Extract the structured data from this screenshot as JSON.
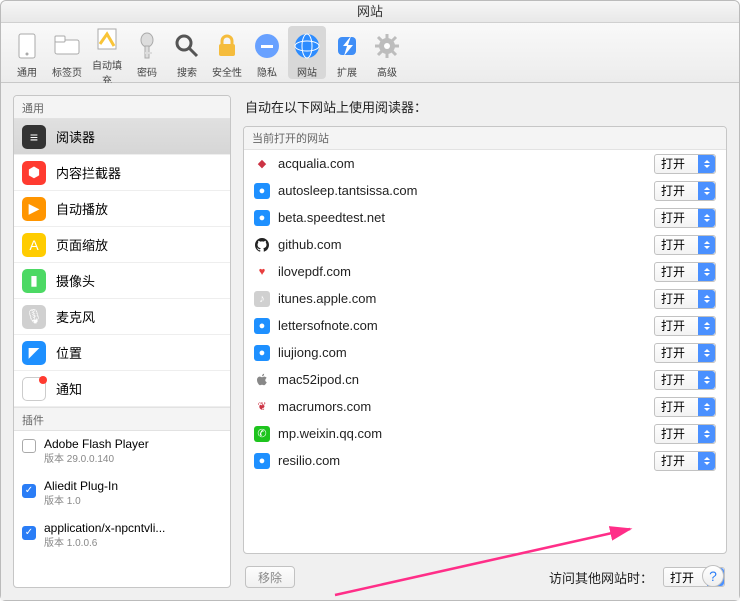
{
  "window_title": "网站",
  "toolbar": [
    {
      "name": "general",
      "label": "通用"
    },
    {
      "name": "tabs",
      "label": "标签页"
    },
    {
      "name": "autofill",
      "label": "自动填充"
    },
    {
      "name": "passwords",
      "label": "密码"
    },
    {
      "name": "search",
      "label": "搜索"
    },
    {
      "name": "security",
      "label": "安全性"
    },
    {
      "name": "privacy",
      "label": "隐私"
    },
    {
      "name": "websites",
      "label": "网站",
      "active": true
    },
    {
      "name": "extensions",
      "label": "扩展"
    },
    {
      "name": "advanced",
      "label": "高级"
    }
  ],
  "sidebar": {
    "general_header": "通用",
    "plugins_header": "插件",
    "items": [
      {
        "name": "reader",
        "label": "阅读器",
        "selected": true,
        "icon_bg": "#333",
        "icon_char": "≡"
      },
      {
        "name": "content-blocker",
        "label": "内容拦截器",
        "icon_bg": "#ff3b30",
        "icon_char": "⬢"
      },
      {
        "name": "autoplay",
        "label": "自动播放",
        "icon_bg": "#ff9500",
        "icon_char": "▶"
      },
      {
        "name": "page-zoom",
        "label": "页面缩放",
        "icon_bg": "#ffcc00",
        "icon_char": "A"
      },
      {
        "name": "camera",
        "label": "摄像头",
        "icon_bg": "#4cd964",
        "icon_char": "▮"
      },
      {
        "name": "microphone",
        "label": "麦克风",
        "icon_bg": "#d0d0d0",
        "icon_char": "🎙"
      },
      {
        "name": "location",
        "label": "位置",
        "icon_bg": "#1e90ff",
        "icon_char": "◤"
      },
      {
        "name": "notifications",
        "label": "通知",
        "icon_bg": "#fff",
        "icon_char": "",
        "badge": true
      }
    ],
    "plugins": [
      {
        "label": "Adobe Flash Player",
        "sub": "版本 29.0.0.140",
        "checked": false
      },
      {
        "label": "Aliedit Plug-In",
        "sub": "版本 1.0",
        "checked": true
      },
      {
        "label": "application/x-npcntvli...",
        "sub": "版本 1.0.0.6",
        "checked": true
      }
    ]
  },
  "main": {
    "heading": "自动在以下网站上使用阅读器：",
    "open_sites_header": "当前打开的网站",
    "remove_button": "移除",
    "other_sites_label": "访问其他网站时：",
    "default_option": "打开",
    "sites": [
      {
        "domain": "acqualia.com",
        "option": "打开",
        "fav_bg": "#fff",
        "fav_char": "◆",
        "fav_color": "#c34"
      },
      {
        "domain": "autosleep.tantsissa.com",
        "option": "打开",
        "fav_bg": "#1e90ff",
        "fav_char": "●",
        "fav_color": "#fff"
      },
      {
        "domain": "beta.speedtest.net",
        "option": "打开",
        "fav_bg": "#1e90ff",
        "fav_char": "●",
        "fav_color": "#fff"
      },
      {
        "domain": "github.com",
        "option": "打开",
        "fav_bg": "#fff",
        "fav_char": "",
        "fav_svg": "github"
      },
      {
        "domain": "ilovepdf.com",
        "option": "打开",
        "fav_bg": "#fff",
        "fav_char": "♥",
        "fav_color": "#e83e3e"
      },
      {
        "domain": "itunes.apple.com",
        "option": "打开",
        "fav_bg": "#d0d0d0",
        "fav_char": "♪",
        "fav_color": "#fff"
      },
      {
        "domain": "lettersofnote.com",
        "option": "打开",
        "fav_bg": "#1e90ff",
        "fav_char": "●",
        "fav_color": "#fff"
      },
      {
        "domain": "liujiong.com",
        "option": "打开",
        "fav_bg": "#1e90ff",
        "fav_char": "●",
        "fav_color": "#fff"
      },
      {
        "domain": "mac52ipod.cn",
        "option": "打开",
        "fav_bg": "#fff",
        "fav_char": "",
        "fav_color": "#888",
        "fav_svg": "apple"
      },
      {
        "domain": "macrumors.com",
        "option": "打开",
        "fav_bg": "#fff",
        "fav_char": "❦",
        "fav_color": "#c34"
      },
      {
        "domain": "mp.weixin.qq.com",
        "option": "打开",
        "fav_bg": "#1ec41e",
        "fav_char": "✆",
        "fav_color": "#fff"
      },
      {
        "domain": "resilio.com",
        "option": "打开",
        "fav_bg": "#1e90ff",
        "fav_char": "●",
        "fav_color": "#fff"
      }
    ]
  }
}
